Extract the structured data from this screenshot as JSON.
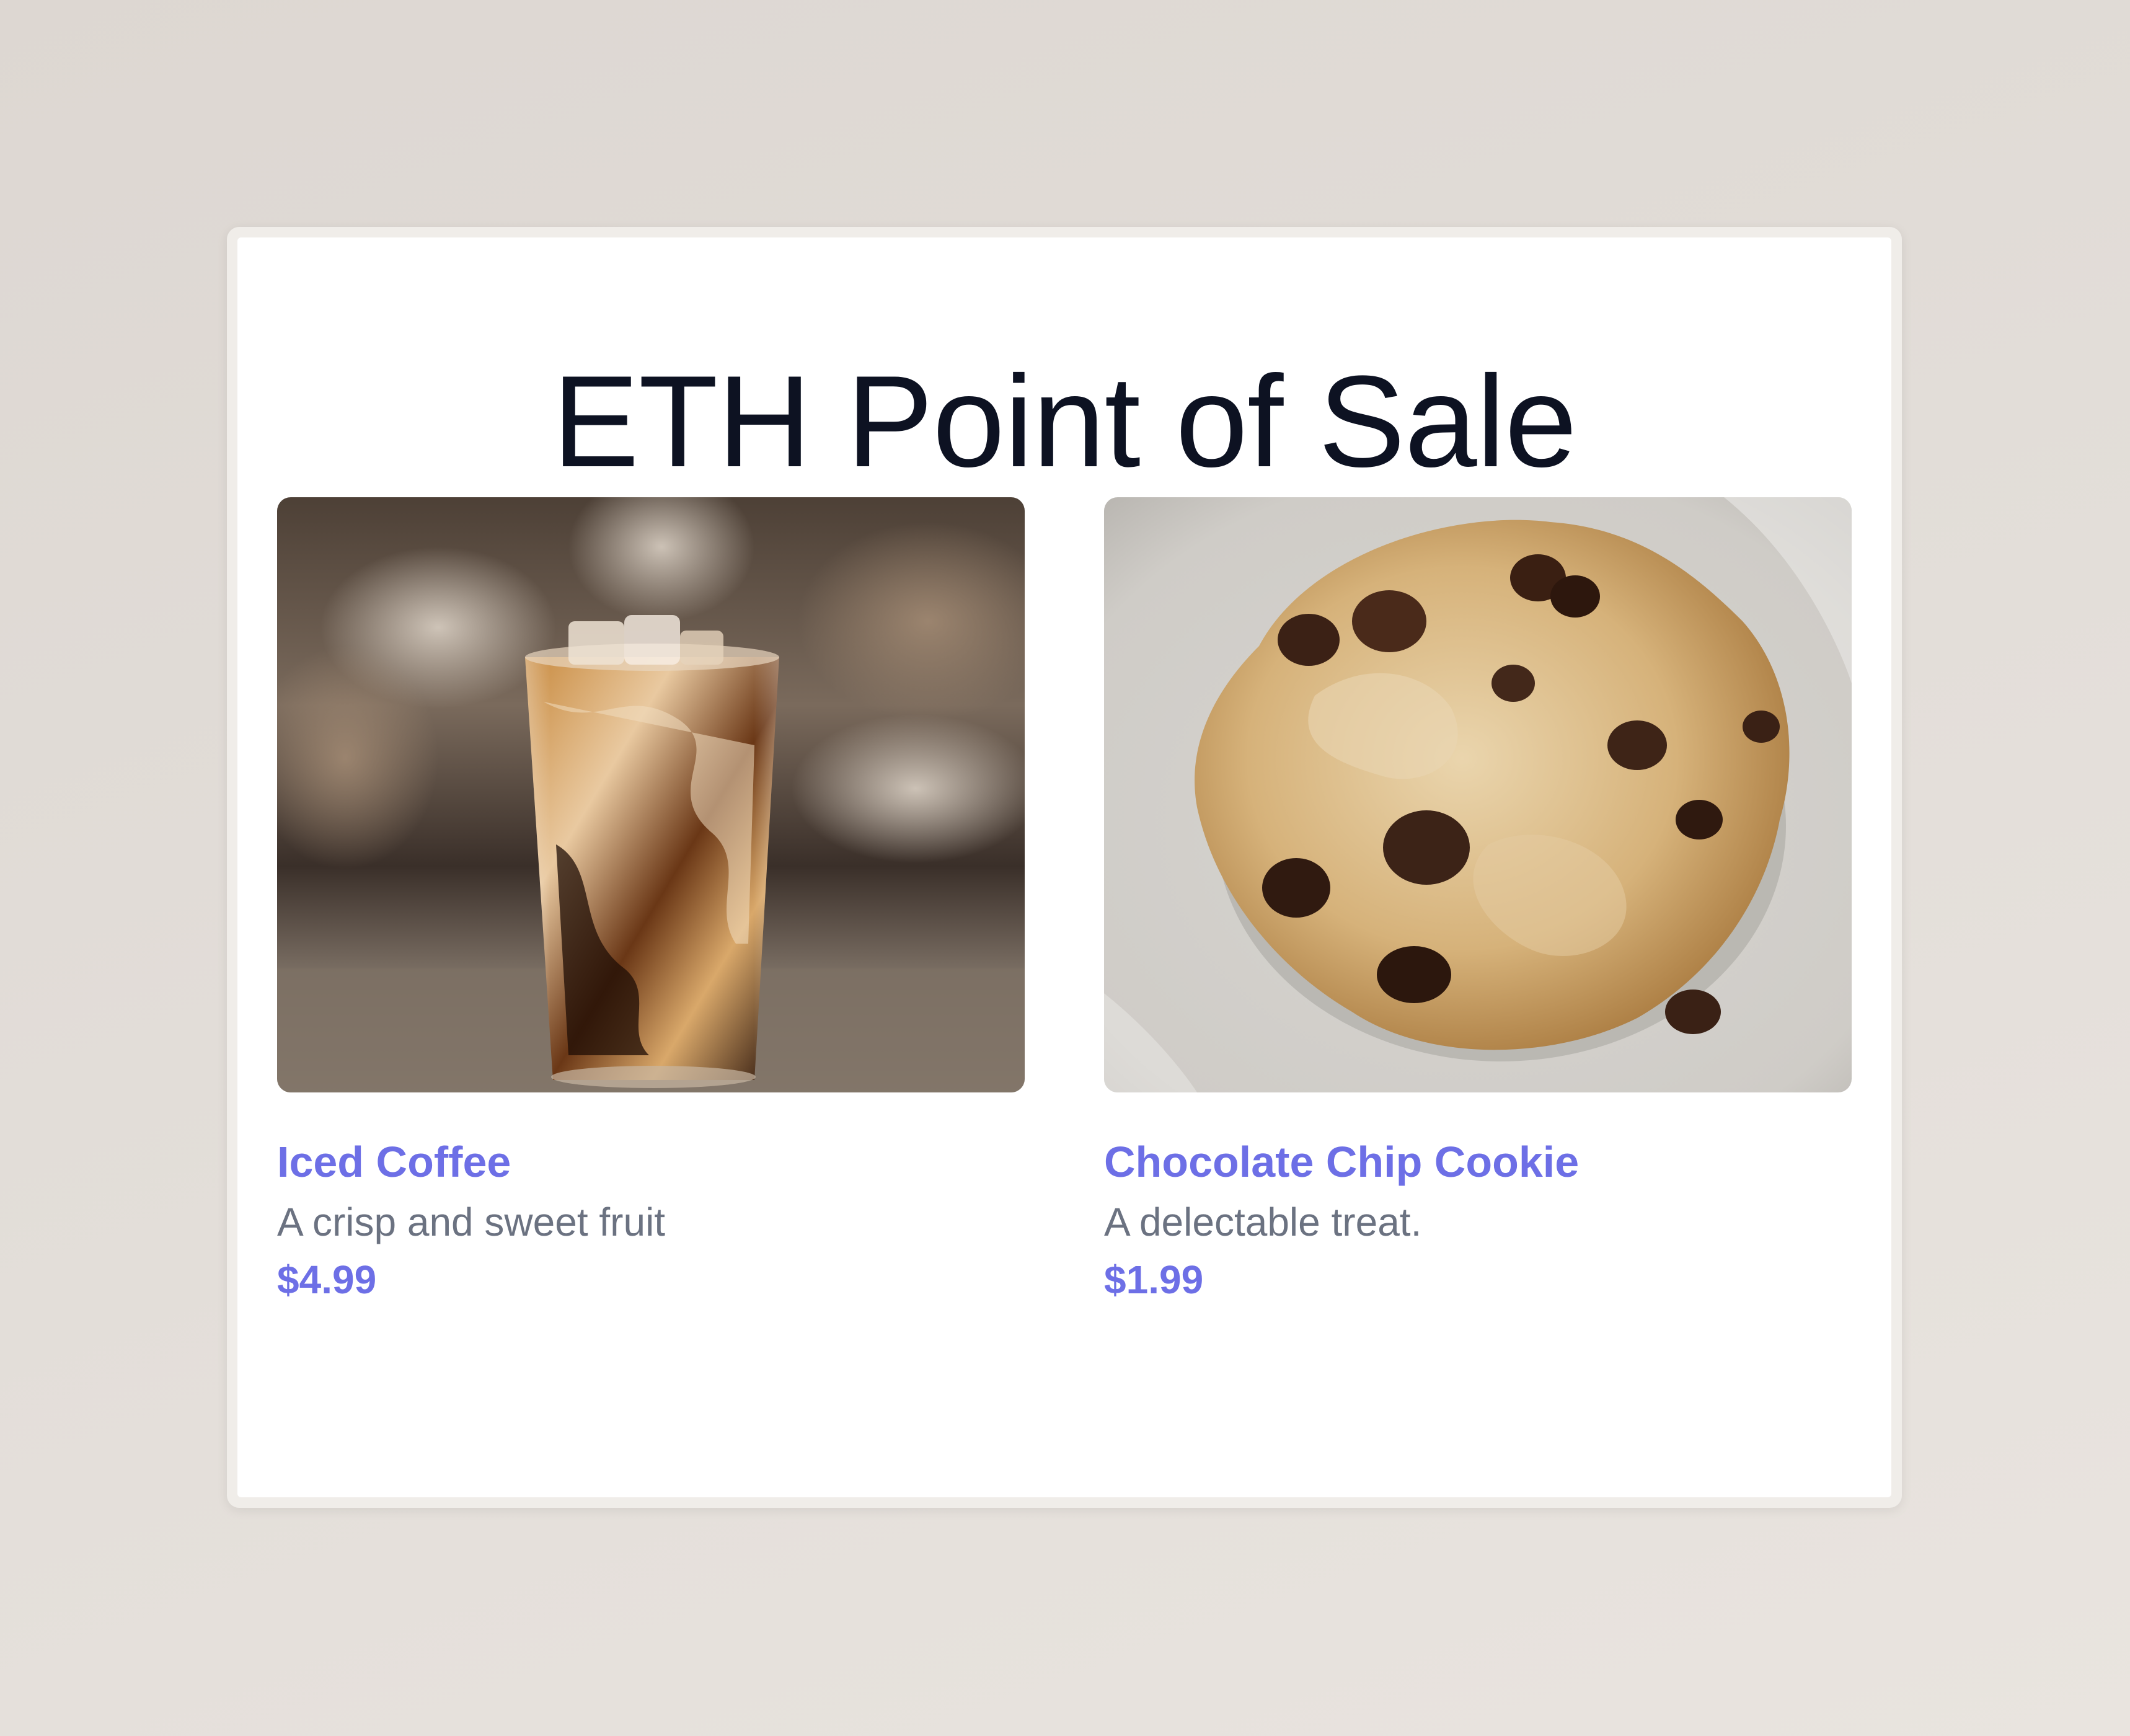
{
  "page": {
    "title": "ETH Point of Sale"
  },
  "products": [
    {
      "name": "Iced Coffee",
      "description": "A crisp and sweet fruit",
      "price": "$4.99",
      "image_icon": "iced-coffee-photo"
    },
    {
      "name": "Chocolate Chip Cookie",
      "description": "A delectable treat.",
      "price": "$1.99",
      "image_icon": "chocolate-chip-cookie-photo"
    }
  ],
  "colors": {
    "accent": "#6d6fe6",
    "title": "#0d1222",
    "muted": "#6b7281",
    "background": "#e2ddd8",
    "card": "#ffffff"
  }
}
